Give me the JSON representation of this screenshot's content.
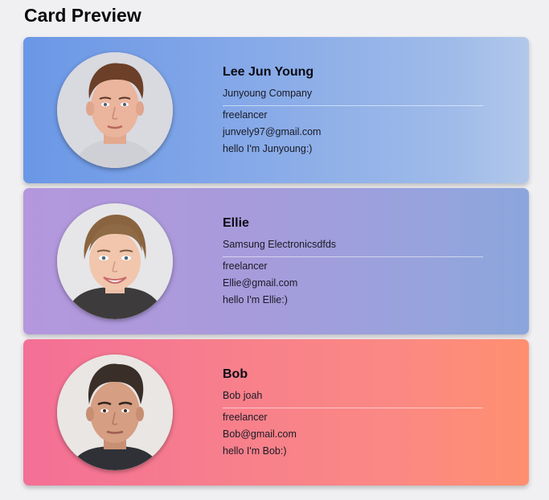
{
  "page_title": "Card Preview",
  "cards": [
    {
      "name": "Lee Jun Young",
      "company": "Junyoung Company",
      "job": "freelancer",
      "email": "junvely97@gmail.com",
      "intro": "hello I'm Junyoung:)",
      "avatar": "profile-photo-man-short-brown-hair",
      "gradient": [
        "#6a97e6",
        "#b2c8ea"
      ]
    },
    {
      "name": "Ellie",
      "company": "Samsung Electronicsdfds",
      "job": "freelancer",
      "email": "Ellie@gmail.com",
      "intro": "hello I'm Ellie:)",
      "avatar": "profile-photo-woman-smiling",
      "gradient": [
        "#b497dd",
        "#8ba6dc"
      ]
    },
    {
      "name": "Bob",
      "company": "Bob joah",
      "job": "freelancer",
      "email": "Bob@gmail.com",
      "intro": "hello I'm Bob:)",
      "avatar": "profile-photo-man-dark-hair",
      "gradient": [
        "#f46f96",
        "#ff8f6f"
      ]
    }
  ]
}
